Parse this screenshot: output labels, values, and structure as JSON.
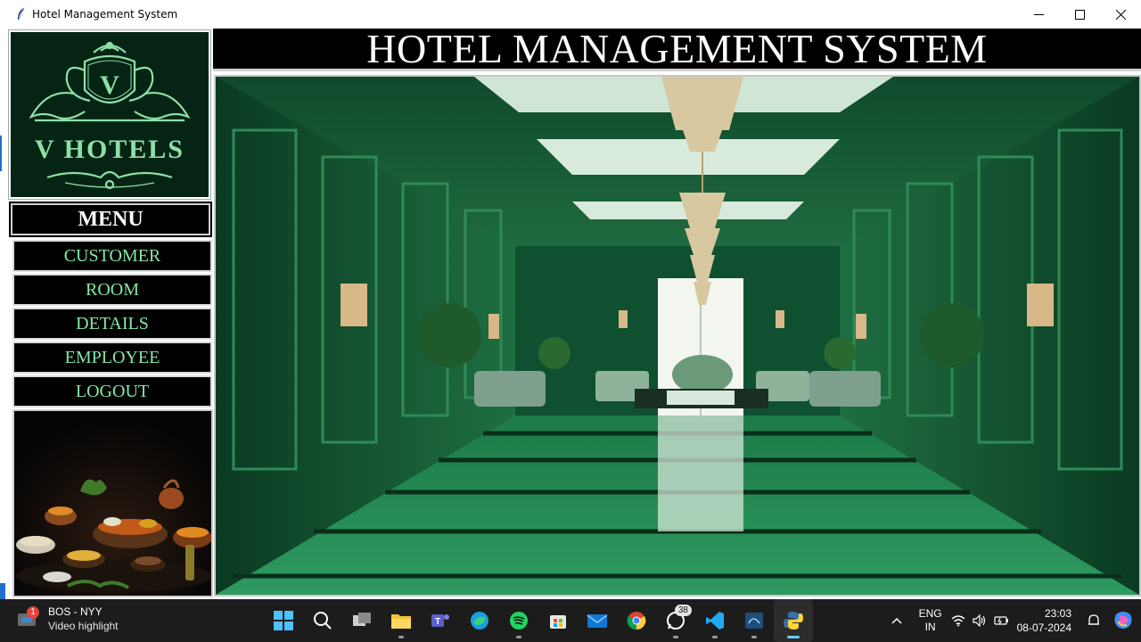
{
  "window": {
    "title": "Hotel Management System",
    "controls": {
      "minimize": "—",
      "maximize": "☐",
      "close": "✕"
    }
  },
  "logo": {
    "monogram": "V",
    "brand": "V HOTELS",
    "accent": "#8ee0a8",
    "background": "#062414"
  },
  "header": {
    "title": "HOTEL MANAGEMENT SYSTEM"
  },
  "menu": {
    "title": "MENU",
    "items": [
      {
        "id": "customer",
        "label": "CUSTOMER"
      },
      {
        "id": "room",
        "label": "ROOM"
      },
      {
        "id": "details",
        "label": "DETAILS"
      },
      {
        "id": "employee",
        "label": "EMPLOYEE"
      },
      {
        "id": "logout",
        "label": "LOGOUT"
      }
    ],
    "text_color": "#86e6a6"
  },
  "taskbar": {
    "news": {
      "badge": "1",
      "line1": "BOS - NYY",
      "line2": "Video highlight"
    },
    "apps": [
      {
        "name": "start-icon"
      },
      {
        "name": "search-icon"
      },
      {
        "name": "task-view-icon"
      },
      {
        "name": "file-explorer-icon"
      },
      {
        "name": "teams-icon"
      },
      {
        "name": "edge-icon"
      },
      {
        "name": "spotify-icon"
      },
      {
        "name": "store-icon"
      },
      {
        "name": "mail-icon"
      },
      {
        "name": "chrome-icon"
      },
      {
        "name": "whatsapp-icon",
        "badge": "38"
      },
      {
        "name": "vscode-icon"
      },
      {
        "name": "sql-icon"
      },
      {
        "name": "python-icon"
      }
    ],
    "tray": {
      "lang1": "ENG",
      "lang2": "IN",
      "time": "23:03",
      "date": "08-07-2024"
    }
  }
}
